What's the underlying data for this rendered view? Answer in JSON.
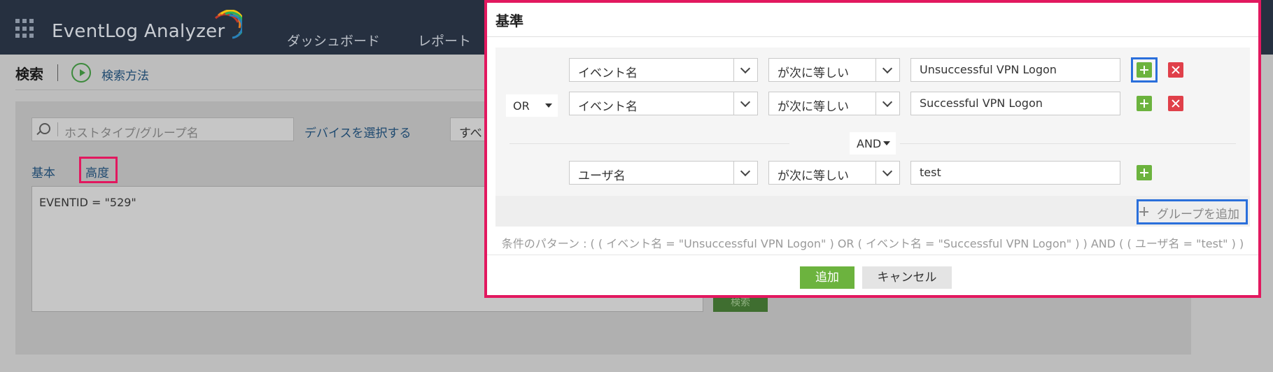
{
  "app": {
    "brand": "EventLog Analyzer",
    "nav": [
      "ダッシュボード",
      "レポート"
    ]
  },
  "page": {
    "title": "検索",
    "search_method": "検索方法",
    "host_placeholder": "ホストタイプ/グループ名",
    "select_device": "デバイスを選択する",
    "all_select": "すべ",
    "tabs": [
      "基本",
      "高度"
    ],
    "query": "EVENTID = \"529\"",
    "search_button": "検索"
  },
  "modal": {
    "title": "基準",
    "group_op": "OR",
    "between_groups_op": "AND",
    "rows": [
      {
        "field": "イベント名",
        "operator": "が次に等しい",
        "value": "Unsuccessful VPN Logon"
      },
      {
        "field": "イベント名",
        "operator": "が次に等しい",
        "value": "Successful VPN Logon"
      },
      {
        "field": "ユーザ名",
        "operator": "が次に等しい",
        "value": "test"
      }
    ],
    "add_group": "グループを追加",
    "pattern": "条件のパターン : ( ( イベント名 = \"Unsuccessful VPN Logon\" ) OR ( イベント名 = \"Successful VPN Logon\" ) ) AND ( ( ユーザ名 = \"test\" ) )",
    "add_button": "追加",
    "cancel_button": "キャンセル"
  },
  "colors": {
    "highlight_pink": "#e2185f",
    "highlight_blue": "#2a6fdb",
    "accent_green": "#6cb33e",
    "delete_red": "#e0404a"
  }
}
